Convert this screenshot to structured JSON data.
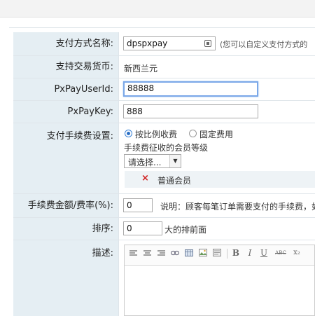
{
  "form": {
    "method_name": {
      "label": "支付方式名称:",
      "value": "dpspxpay",
      "hint": "(您可以自定义支付方式的"
    },
    "currency": {
      "label": "支持交易货币:",
      "value": "新西兰元"
    },
    "user_id": {
      "label": "PxPayUserId:",
      "value": "88888"
    },
    "key": {
      "label": "PxPayKey:",
      "value": "888"
    },
    "fee": {
      "label": "支付手续费设置:",
      "option_ratio": "按比例收费",
      "option_fixed": "固定费用",
      "selected": "按比例收费",
      "member_level_label": "手续费征收的会员等级",
      "select_placeholder": "请选择...",
      "selected_level": "普通会员",
      "remove_symbol": "×"
    },
    "fee_amount": {
      "label": "手续费金额/费率(%):",
      "value": "0",
      "note": "说明：顾客每笔订单需要支付的手续费，如"
    },
    "sort": {
      "label": "排序:",
      "value": "0",
      "note": "大的排前面"
    },
    "description": {
      "label": "描述:"
    }
  },
  "editor": {
    "tools": [
      "align-left",
      "align-center",
      "align-right",
      "link",
      "table",
      "image",
      "media",
      "bold",
      "italic",
      "underline",
      "strikethrough",
      "subscript"
    ],
    "labels": {
      "bold": "B",
      "italic": "I",
      "underline": "U",
      "strike": "ABC",
      "subscript": "x₂"
    }
  }
}
